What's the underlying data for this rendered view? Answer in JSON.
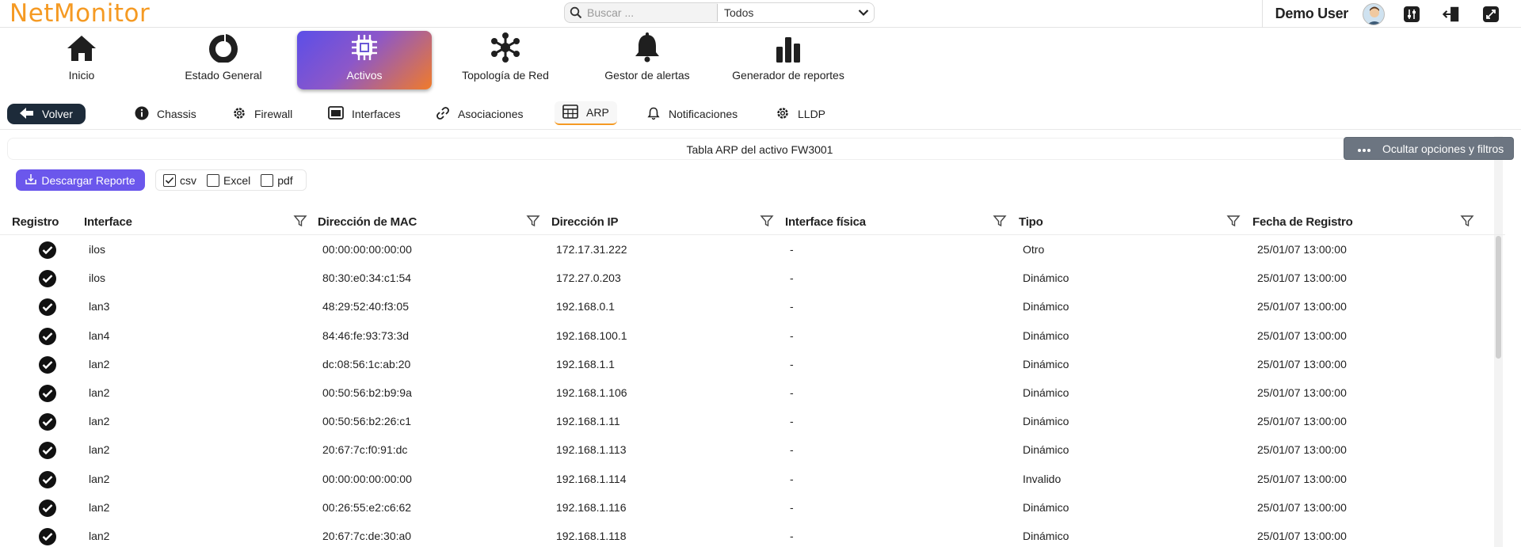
{
  "app": {
    "logo": "NetMonitor"
  },
  "search": {
    "placeholder": "Buscar ...",
    "scope": "Todos"
  },
  "user": {
    "name": "Demo User"
  },
  "topbar_icons": [
    "avatar",
    "equalizer-icon",
    "logout-icon",
    "switch-icon"
  ],
  "main_nav": [
    {
      "label": "Inicio",
      "icon": "home-icon"
    },
    {
      "label": "Estado General",
      "icon": "donut-icon"
    },
    {
      "label": "Activos",
      "icon": "chip-icon",
      "active": true
    },
    {
      "label": "Topología de Red",
      "icon": "network-icon"
    },
    {
      "label": "Gestor de alertas",
      "icon": "bell-icon"
    },
    {
      "label": "Generador de reportes",
      "icon": "bar-chart-icon"
    }
  ],
  "sub_nav": {
    "back_label": "Volver",
    "tabs": [
      {
        "label": "Chassis",
        "icon": "info-icon"
      },
      {
        "label": "Firewall",
        "icon": "gear-icon"
      },
      {
        "label": "Interfaces",
        "icon": "monitor-icon"
      },
      {
        "label": "Asociaciones",
        "icon": "link-icon"
      },
      {
        "label": "ARP",
        "icon": "table-icon",
        "active": true
      },
      {
        "label": "Notificaciones",
        "icon": "bell-outline-icon"
      },
      {
        "label": "LLDP",
        "icon": "gear-icon"
      }
    ]
  },
  "page": {
    "title": "Tabla ARP del activo FW3001",
    "hide_filters_label": "Ocultar opciones y filtros",
    "download_label": "Descargar Reporte",
    "formats": [
      {
        "label": "csv",
        "checked": true
      },
      {
        "label": "Excel",
        "checked": false
      },
      {
        "label": "pdf",
        "checked": false
      }
    ]
  },
  "table": {
    "columns": [
      "Registro",
      "Interface",
      "Dirección de MAC",
      "Dirección IP",
      "Interface física",
      "Tipo",
      "Fecha de Registro"
    ],
    "rows": [
      {
        "iface": "ilos",
        "mac": "00:00:00:00:00:00",
        "ip": "172.17.31.222",
        "phys": "-",
        "type": "Otro",
        "date": "25/01/07 13:00:00"
      },
      {
        "iface": "ilos",
        "mac": "80:30:e0:34:c1:54",
        "ip": "172.27.0.203",
        "phys": "-",
        "type": "Dinámico",
        "date": "25/01/07 13:00:00"
      },
      {
        "iface": "lan3",
        "mac": "48:29:52:40:f3:05",
        "ip": "192.168.0.1",
        "phys": "-",
        "type": "Dinámico",
        "date": "25/01/07 13:00:00"
      },
      {
        "iface": "lan4",
        "mac": "84:46:fe:93:73:3d",
        "ip": "192.168.100.1",
        "phys": "-",
        "type": "Dinámico",
        "date": "25/01/07 13:00:00"
      },
      {
        "iface": "lan2",
        "mac": "dc:08:56:1c:ab:20",
        "ip": "192.168.1.1",
        "phys": "-",
        "type": "Dinámico",
        "date": "25/01/07 13:00:00"
      },
      {
        "iface": "lan2",
        "mac": "00:50:56:b2:b9:9a",
        "ip": "192.168.1.106",
        "phys": "-",
        "type": "Dinámico",
        "date": "25/01/07 13:00:00"
      },
      {
        "iface": "lan2",
        "mac": "00:50:56:b2:26:c1",
        "ip": "192.168.1.11",
        "phys": "-",
        "type": "Dinámico",
        "date": "25/01/07 13:00:00"
      },
      {
        "iface": "lan2",
        "mac": "20:67:7c:f0:91:dc",
        "ip": "192.168.1.113",
        "phys": "-",
        "type": "Dinámico",
        "date": "25/01/07 13:00:00"
      },
      {
        "iface": "lan2",
        "mac": "00:00:00:00:00:00",
        "ip": "192.168.1.114",
        "phys": "-",
        "type": "Invalido",
        "date": "25/01/07 13:00:00"
      },
      {
        "iface": "lan2",
        "mac": "00:26:55:e2:c6:62",
        "ip": "192.168.1.116",
        "phys": "-",
        "type": "Dinámico",
        "date": "25/01/07 13:00:00"
      },
      {
        "iface": "lan2",
        "mac": "20:67:7c:de:30:a0",
        "ip": "192.168.1.118",
        "phys": "-",
        "type": "Dinámico",
        "date": "25/01/07 13:00:00"
      }
    ]
  },
  "colors": {
    "brand": "#f59a23",
    "accent": "#6b57ec",
    "dark": "#1d2b3a"
  }
}
